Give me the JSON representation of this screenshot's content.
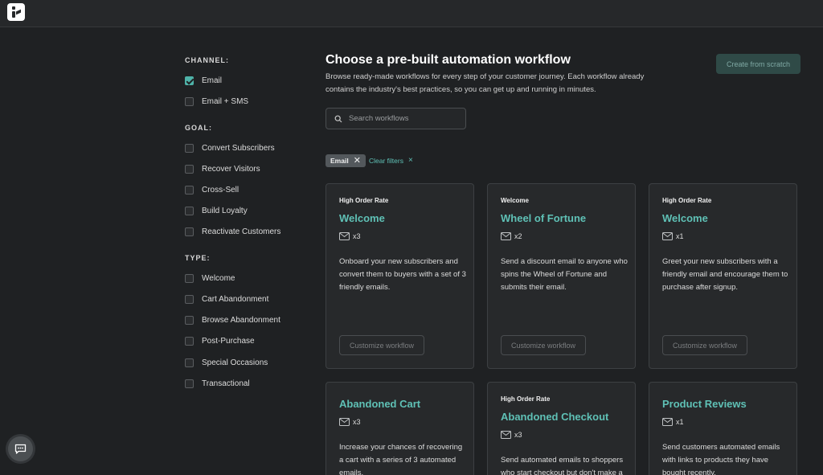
{
  "header": {
    "logo_icon": "brand-logo-icon"
  },
  "sidebar": {
    "channel": {
      "title": "CHANNEL:",
      "options": [
        {
          "label": "Email",
          "checked": true
        },
        {
          "label": "Email + SMS",
          "checked": false
        }
      ]
    },
    "goal": {
      "title": "GOAL:",
      "options": [
        {
          "label": "Convert Subscribers",
          "checked": false
        },
        {
          "label": "Recover Visitors",
          "checked": false
        },
        {
          "label": "Cross-Sell",
          "checked": false
        },
        {
          "label": "Build Loyalty",
          "checked": false
        },
        {
          "label": "Reactivate Customers",
          "checked": false
        }
      ]
    },
    "type": {
      "title": "TYPE:",
      "options": [
        {
          "label": "Welcome",
          "checked": false
        },
        {
          "label": "Cart Abandonment",
          "checked": false
        },
        {
          "label": "Browse Abandonment",
          "checked": false
        },
        {
          "label": "Post-Purchase",
          "checked": false
        },
        {
          "label": "Special Occasions",
          "checked": false
        },
        {
          "label": "Transactional",
          "checked": false
        }
      ]
    }
  },
  "main": {
    "title": "Choose a pre-built automation workflow",
    "description": "Browse ready-made workflows for every step of your customer journey. Each workflow already contains the industry's best practices, so you can get up and running in minutes.",
    "create_button": "Create from scratch",
    "search": {
      "placeholder": "Search workflows",
      "value": ""
    },
    "active_filter": "Email",
    "clear_filters": "Clear filters",
    "cards": [
      {
        "tag": "High Order Rate",
        "title": "Welcome",
        "count": "x3",
        "description": "Onboard your new subscribers and convert them to buyers with a set of 3 friendly emails.",
        "button": "Customize workflow"
      },
      {
        "tag": "Welcome",
        "title": "Wheel of Fortune",
        "count": "x2",
        "description": "Send a discount email to anyone who spins the Wheel of Fortune and submits their email.",
        "button": "Customize workflow"
      },
      {
        "tag": "High Order Rate",
        "title": "Welcome",
        "count": "x1",
        "description": "Greet your new subscribers with a friendly email and encourage them to purchase after signup.",
        "button": "Customize workflow"
      },
      {
        "tag": "",
        "title": "Abandoned Cart",
        "count": "x3",
        "description": "Increase your chances of recovering a cart with a series of 3 automated emails.",
        "button": ""
      },
      {
        "tag": "High Order Rate",
        "title": "Abandoned Checkout",
        "count": "x3",
        "description": "Send automated emails to shoppers who start checkout but don't make a",
        "button": ""
      },
      {
        "tag": "",
        "title": "Product Reviews",
        "count": "x1",
        "description": "Send customers automated emails with links to products they have bought recently.",
        "button": ""
      }
    ]
  },
  "colors": {
    "accent": "#5fc1b6",
    "background": "#1f2123",
    "card": "#27292b"
  }
}
